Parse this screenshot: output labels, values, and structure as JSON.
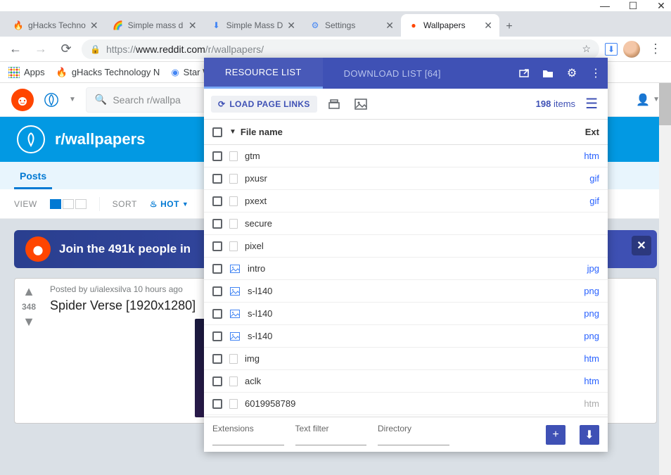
{
  "window": {
    "min": "—",
    "max": "☐",
    "close": "✕"
  },
  "tabs": [
    {
      "title": "gHacks Technology News",
      "short": "gHacks Techno"
    },
    {
      "title": "Simple mass downloader",
      "short": "Simple mass d"
    },
    {
      "title": "Simple Mass Downloader",
      "short": "Simple Mass D"
    },
    {
      "title": "Settings",
      "short": "Settings"
    },
    {
      "title": "Wallpapers",
      "short": "Wallpapers"
    }
  ],
  "url": {
    "proto": "https://",
    "host": "www.reddit.com",
    "path": "/r/wallpapers/"
  },
  "bookmarks": {
    "apps": "Apps",
    "b1": "gHacks Technology N",
    "b2": "Star W"
  },
  "reddit": {
    "search_ph": "Search r/wallpa",
    "subreddit": "r/wallpapers",
    "posts": "Posts",
    "view": "VIEW",
    "sort": "SORT",
    "hot": "HOT",
    "join": "Join the 491k people in",
    "post": {
      "meta": "Posted by u/ialexsilva 10 hours ago",
      "title": "Spider Verse [1920x1280]",
      "score": "348"
    }
  },
  "ext": {
    "tab1": "RESOURCE LIST",
    "tab2": "DOWNLOAD LIST [64]",
    "load": "LOAD PAGE LINKS",
    "count": "198",
    "count_label": "items",
    "header_fn": "File name",
    "header_ext": "Ext",
    "files": [
      {
        "name": "gtm",
        "ext": "htm",
        "type": "doc"
      },
      {
        "name": "pxusr",
        "ext": "gif",
        "type": "doc"
      },
      {
        "name": "pxext",
        "ext": "gif",
        "type": "doc"
      },
      {
        "name": "secure",
        "ext": "",
        "type": "doc"
      },
      {
        "name": "pixel",
        "ext": "",
        "type": "doc"
      },
      {
        "name": "intro",
        "ext": "jpg",
        "type": "img"
      },
      {
        "name": "s-l140",
        "ext": "png",
        "type": "img"
      },
      {
        "name": "s-l140",
        "ext": "png",
        "type": "img"
      },
      {
        "name": "s-l140",
        "ext": "png",
        "type": "img"
      },
      {
        "name": "img",
        "ext": "htm",
        "type": "doc"
      },
      {
        "name": "aclk",
        "ext": "htm",
        "type": "doc"
      },
      {
        "name": "6019958789",
        "ext": "htm",
        "type": "doc",
        "muted": true
      }
    ],
    "filters": {
      "extensions": "Extensions",
      "text": "Text filter",
      "directory": "Directory"
    }
  }
}
